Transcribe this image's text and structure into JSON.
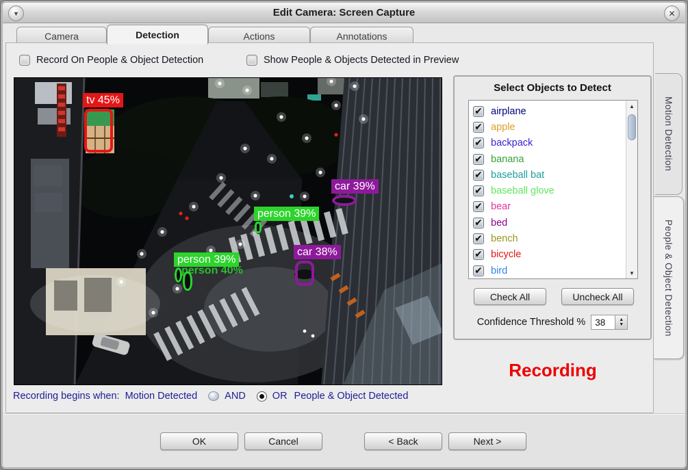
{
  "window": {
    "title": "Edit Camera: Screen Capture"
  },
  "icons": {
    "menu": "▼",
    "close": "✕",
    "check": "✔",
    "arrow_up": "▲",
    "arrow_down": "▼"
  },
  "tabs": [
    {
      "label": "Camera",
      "active": false
    },
    {
      "label": "Detection",
      "active": true
    },
    {
      "label": "Actions",
      "active": false
    },
    {
      "label": "Annotations",
      "active": false
    }
  ],
  "options": {
    "record_label": "Record On People & Object Detection",
    "show_label": "Show People & Objects Detected in Preview"
  },
  "preview": {
    "detections": [
      {
        "label": "tv 45%",
        "color": "#e51616"
      },
      {
        "label": "car 39%",
        "color": "#8e1a9b"
      },
      {
        "label": "person 39%",
        "color": "#2cd42c"
      },
      {
        "label": "person 39%",
        "sub_label": "person 40%",
        "color": "#2cd42c"
      },
      {
        "label": "car 38%",
        "color": "#8e1a9b"
      }
    ]
  },
  "objects_panel": {
    "title": "Select Objects to Detect",
    "items": [
      {
        "label": "airplane",
        "color": "#000080",
        "checked": true
      },
      {
        "label": "apple",
        "color": "#de9d2a",
        "checked": true
      },
      {
        "label": "backpack",
        "color": "#3a1fd0",
        "checked": true
      },
      {
        "label": "banana",
        "color": "#35a435",
        "checked": true
      },
      {
        "label": "baseball bat",
        "color": "#1d9e9e",
        "checked": true
      },
      {
        "label": "baseball glove",
        "color": "#5fe85f",
        "checked": true
      },
      {
        "label": "bear",
        "color": "#e0359f",
        "checked": true
      },
      {
        "label": "bed",
        "color": "#8b008b",
        "checked": true
      },
      {
        "label": "bench",
        "color": "#98981d",
        "checked": true
      },
      {
        "label": "bicycle",
        "color": "#e81414",
        "checked": true
      },
      {
        "label": "bird",
        "color": "#2e86e8",
        "checked": true
      }
    ],
    "check_all": "Check All",
    "uncheck_all": "Uncheck All",
    "confidence_label": "Confidence Threshold %",
    "confidence_value": "38"
  },
  "side_tabs": [
    {
      "label": "Motion Detection",
      "active": false
    },
    {
      "label": "People & Object Detection",
      "active": true
    }
  ],
  "status": {
    "recording": "Recording",
    "color": "#ee0000"
  },
  "recording_rule": {
    "prefix": "Recording begins when:",
    "motion": "Motion Detected",
    "and_label": "AND",
    "or_label": "OR",
    "people": "People & Object Detected",
    "selected": "OR"
  },
  "footer_buttons": {
    "ok": "OK",
    "cancel": "Cancel",
    "back": "< Back",
    "next": "Next >"
  }
}
